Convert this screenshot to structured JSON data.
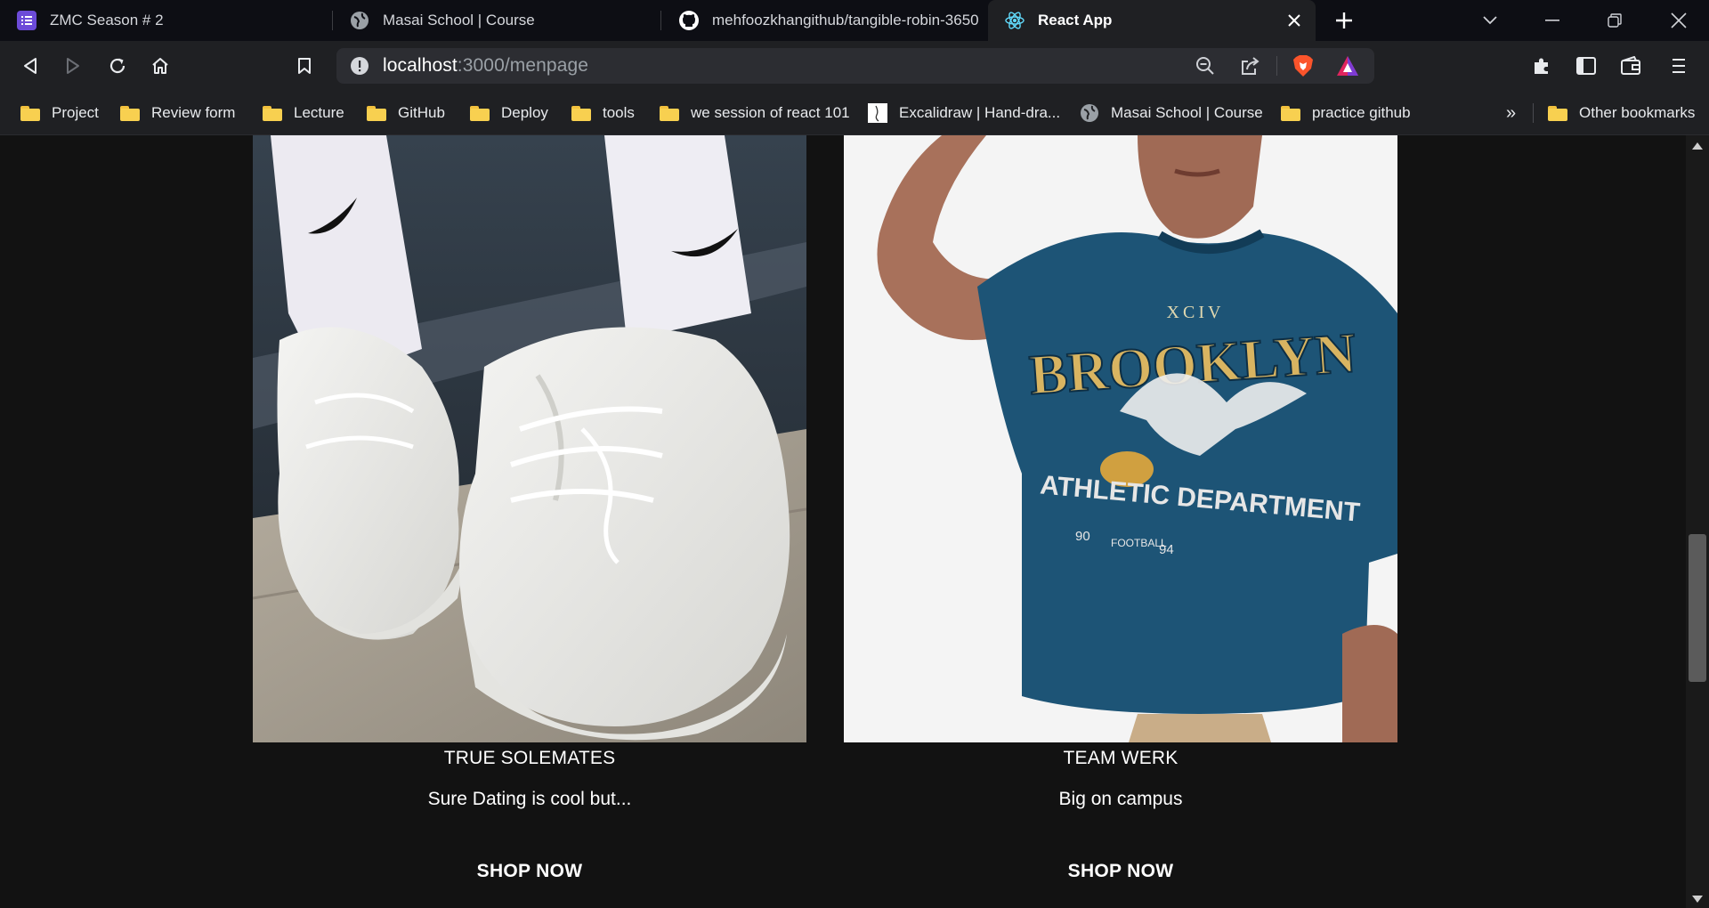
{
  "tabs": [
    {
      "title": "ZMC Season # 2",
      "icon": "list-icon",
      "active": false
    },
    {
      "title": "Masai School | Course",
      "icon": "globe-icon",
      "active": false
    },
    {
      "title": "mehfoozkhangithub/tangible-robin-3650",
      "icon": "github-icon",
      "active": false
    },
    {
      "title": "React App",
      "icon": "react-icon",
      "active": true
    }
  ],
  "address_bar": {
    "host": "localhost",
    "path": ":3000/menpage"
  },
  "bookmarks": [
    {
      "label": "Project",
      "icon": "folder-icon"
    },
    {
      "label": "Review form",
      "icon": "folder-icon"
    },
    {
      "label": "Lecture",
      "icon": "folder-icon"
    },
    {
      "label": "GitHub",
      "icon": "folder-icon"
    },
    {
      "label": "Deploy",
      "icon": "folder-icon"
    },
    {
      "label": "tools",
      "icon": "folder-icon"
    },
    {
      "label": "we session of react 101",
      "icon": "folder-icon"
    },
    {
      "label": "Excalidraw | Hand-dra...",
      "icon": "excalidraw-icon"
    },
    {
      "label": "Masai School | Course",
      "icon": "globe-icon"
    },
    {
      "label": "practice github",
      "icon": "folder-icon"
    }
  ],
  "overflow_label": "»",
  "other_bookmarks": "Other bookmarks",
  "products": [
    {
      "title": "TRUE SOLEMATES",
      "subtitle": "Sure Dating is cool but...",
      "cta": "SHOP NOW",
      "image": "white chunky sneakers with white socks"
    },
    {
      "title": "TEAM WERK",
      "subtitle": "Big on campus",
      "cta": "SHOP NOW",
      "image": "man in navy graphic t-shirt"
    }
  ],
  "colors": {
    "page_bg": "#121212",
    "tabstrip_bg": "#0d0e14",
    "toolbar_bg": "#1f2023",
    "omnibox_bg": "#2c2d32",
    "folder": "#f8d050",
    "tshirt": "#1d5476"
  }
}
